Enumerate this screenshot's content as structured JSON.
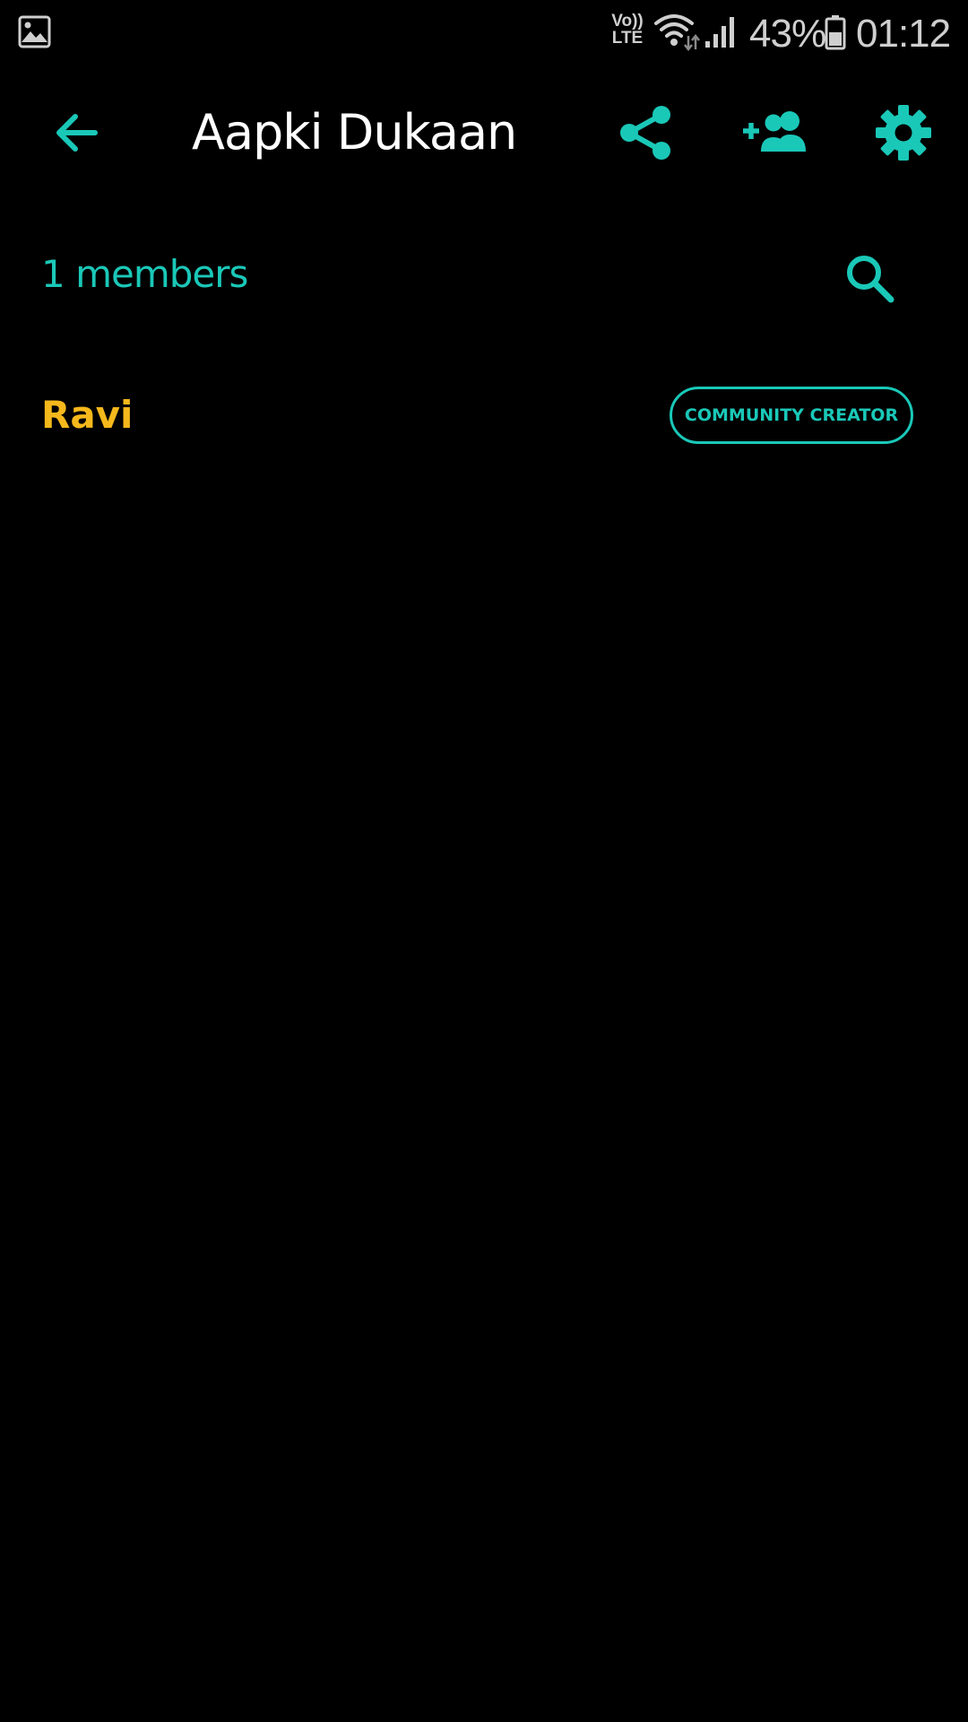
{
  "status_bar": {
    "network_label_top": "Vo))",
    "network_label_bottom": "LTE",
    "battery_percent": "43%",
    "time": "01:12",
    "icons": [
      "gallery-icon",
      "wifi-icon",
      "signal-icon",
      "battery-icon"
    ]
  },
  "toolbar": {
    "title": "Aapki Dukaan",
    "icons": [
      "arrow-back-icon",
      "share-icon",
      "add-member-icon",
      "settings-icon"
    ]
  },
  "members": {
    "count_label": "1 members",
    "search_icon": "search-icon",
    "list": [
      {
        "name": "Ravi",
        "role": "COMMUNITY CREATOR"
      }
    ]
  },
  "colors": {
    "background": "#000000",
    "accent": "#1ac8b8",
    "member_name": "#f5b81c",
    "title": "#ffffff",
    "status_text": "#cfcfcf"
  }
}
